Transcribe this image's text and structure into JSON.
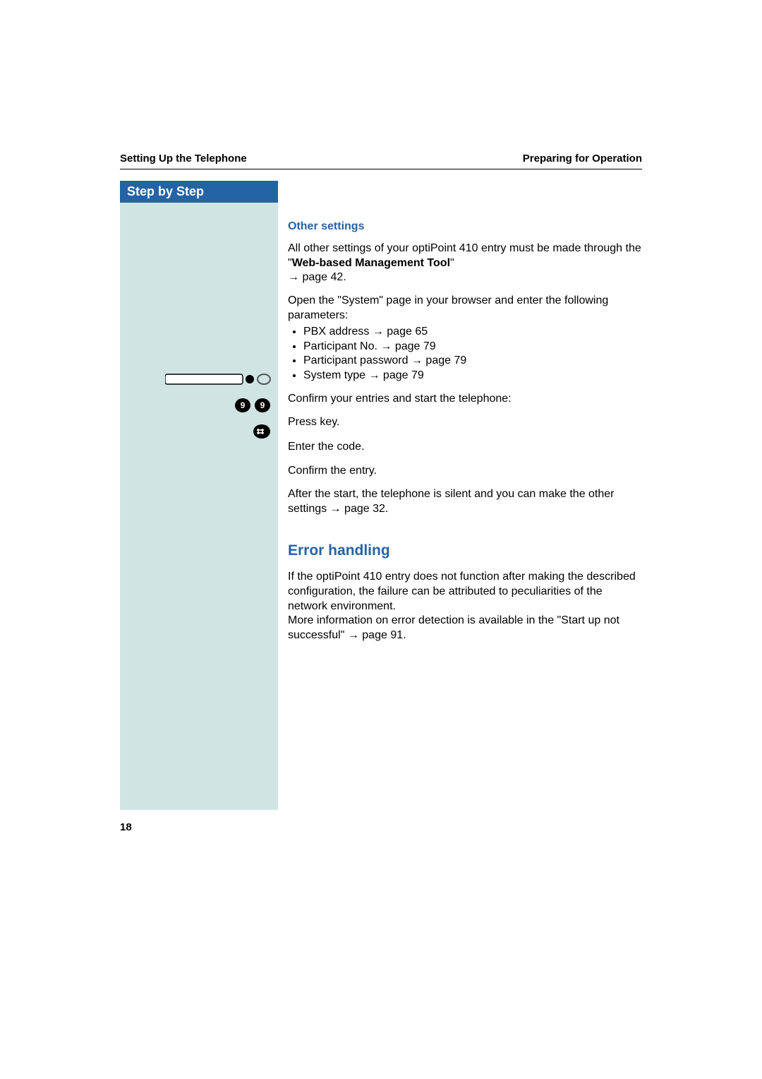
{
  "header": {
    "left": "Setting Up the Telephone",
    "right": "Preparing for Operation"
  },
  "sidebar": {
    "title": "Step by Step"
  },
  "sections": {
    "other_settings": {
      "heading": "Other settings",
      "intro_1a": "All other settings of your optiPoint 410 entry must be made through the \"",
      "intro_1b": "Web-based Management Tool",
      "intro_1c": "\"",
      "intro_1_ref": " page 42.",
      "open_system_1": "Open the \"System\" page in your browser and enter the following parameters:",
      "params": [
        {
          "label": "PBX address ",
          "ref": " page 65"
        },
        {
          "label": "Participant No. ",
          "ref": " page 79"
        },
        {
          "label": "Participant password ",
          "ref": " page 79"
        },
        {
          "label": "System type ",
          "ref": " page 79"
        }
      ],
      "confirm_line": "Confirm your entries and start the telephone:",
      "steps": {
        "press_key": "Press key.",
        "enter_code": "Enter the code.",
        "confirm_entry": "Confirm the entry."
      },
      "after_start_1": "After the start, the telephone is silent and you can make the other settings ",
      "after_start_ref": " page 32."
    },
    "error_handling": {
      "heading": "Error handling",
      "body_1": "If the optiPoint 410 entry does not function after making the described configuration, the failure can be attributed to peculiarities of the network environment.",
      "body_2a": "More information on error detection is available in the \"Start up not successful\" ",
      "body_2_ref": " page 91."
    }
  },
  "page_number": "18",
  "glyphs": {
    "arrow": "→",
    "code_key": "9"
  }
}
